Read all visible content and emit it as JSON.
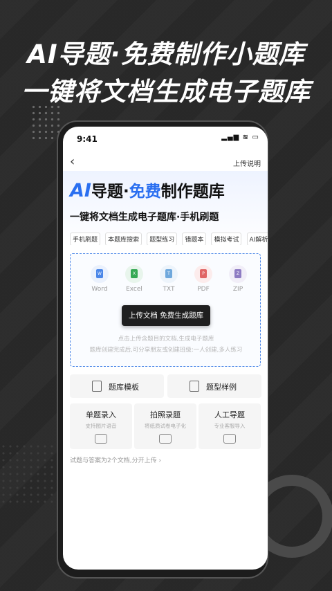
{
  "promo": {
    "line1": "AI导题·免费制作小题库",
    "line2": "一键将文档生成电子题库"
  },
  "status_bar": {
    "time": "9:41",
    "icons": "▂▄▆ ≋ ▭"
  },
  "nav": {
    "back": "‹",
    "help_label": "上传说明"
  },
  "hero": {
    "title_ai": "AI",
    "title_part1": "导题·",
    "title_free": "免费",
    "title_part2": "制作题库",
    "subtitle": "一键将文档生成电子题库·手机刷题"
  },
  "tags": [
    "手机刷题",
    "本题库搜索",
    "题型练习",
    "错题本",
    "模拟考试",
    "AI解析"
  ],
  "upload": {
    "file_types": [
      {
        "label": "Word",
        "color": "#4a86e8",
        "mark": "W"
      },
      {
        "label": "Excel",
        "color": "#34a853",
        "mark": "X"
      },
      {
        "label": "TXT",
        "color": "#6fa8dc",
        "mark": "T"
      },
      {
        "label": "PDF",
        "color": "#e06666",
        "mark": "P"
      },
      {
        "label": "ZIP",
        "color": "#8e7cc3",
        "mark": "Z"
      }
    ],
    "button_label": "上传文档 免费生成题库",
    "hint1": "点击上传含题目的文档,生成电子题库",
    "hint2": "题库创建完成后,可分享朋友或创建班级:一人创建,多人练习"
  },
  "templates": {
    "bank_template": "题库模板",
    "type_example": "题型样例"
  },
  "entry_options": [
    {
      "title": "单题录入",
      "sub": "支持图片语音"
    },
    {
      "title": "拍照录题",
      "sub": "将纸质试卷电子化"
    },
    {
      "title": "人工导题",
      "sub": "专业客服导入"
    }
  ],
  "footnote": "试题与答案为2个文档,分开上传  ›",
  "colors": {
    "accent": "#2a6ff0",
    "upload_border": "#4a86e8",
    "dark_button": "#1f1f1f"
  }
}
